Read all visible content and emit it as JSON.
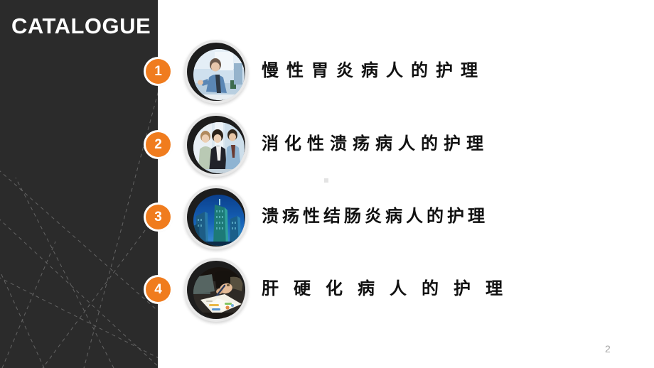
{
  "slide": {
    "title": "CATALOGUE",
    "page_number": "2",
    "panel_color": "#2b2b2b",
    "accent_color": "#f07c1e",
    "background_color": "#ffffff",
    "text_color": "#111111"
  },
  "items": [
    {
      "number": "1",
      "label": "慢性胃炎病人的护理",
      "letter_spacing": "11px",
      "thumbnail": "business-woman-office-photo"
    },
    {
      "number": "2",
      "label": "消化性溃疡病人的护理",
      "letter_spacing": "8px",
      "thumbnail": "business-people-group-photo"
    },
    {
      "number": "3",
      "label": "溃疡性结肠炎病人的护理",
      "letter_spacing": "5px",
      "thumbnail": "city-skyscrapers-photo"
    },
    {
      "number": "4",
      "label": "肝硬化病人的护理",
      "letter_spacing": "21px",
      "thumbnail": "hands-writing-documents-photo"
    }
  ]
}
